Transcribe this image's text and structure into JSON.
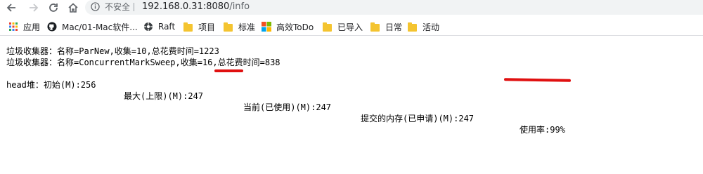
{
  "browser": {
    "security_label": "不安全",
    "url_host": "192.168.0.31:8080",
    "url_path": "/info"
  },
  "bookmarks": [
    {
      "label": "应用",
      "icon": "apps-grid-icon"
    },
    {
      "label": "Mac/01-Mac软件...",
      "icon": "github-icon"
    },
    {
      "label": "Raft",
      "icon": "raft-icon"
    },
    {
      "label": "项目",
      "icon": "folder-icon"
    },
    {
      "label": "标准",
      "icon": "folder-icon"
    },
    {
      "label": "高效ToDo",
      "icon": "todo-icon"
    },
    {
      "label": "已导入",
      "icon": "folder-icon"
    },
    {
      "label": "日常",
      "icon": "folder-icon"
    },
    {
      "label": "活动",
      "icon": "folder-icon"
    }
  ],
  "content": {
    "gc1": "垃圾收集器：名称=ParNew,收集=10,总花费时间=1223",
    "gc2": "垃圾收集器：名称=ConcurrentMarkSweep,收集=16,总花费时间=838",
    "heap_initial": "head堆：初始(M):256",
    "heap_max": "最大(上限)(M):247",
    "heap_used": "当前(已使用)(M):247",
    "heap_committed": "提交的内存(已申请)(M):247",
    "heap_usage": "使用率:99%"
  },
  "annotation_color": "#e01010"
}
